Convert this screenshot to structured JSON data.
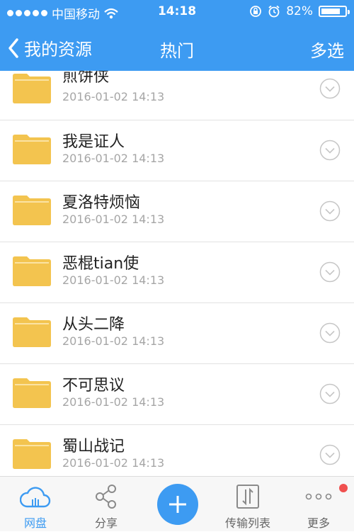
{
  "status": {
    "carrier": "中国移动",
    "time": "14:18",
    "battery": "82%",
    "battery_level": 0.82
  },
  "nav": {
    "back_label": "我的资源",
    "title": "热门",
    "action": "多选"
  },
  "files": [
    {
      "name": "煎饼侠",
      "date": "2016-01-02 14:13"
    },
    {
      "name": "我是证人",
      "date": "2016-01-02 14:13"
    },
    {
      "name": "夏洛特烦恼",
      "date": "2016-01-02 14:13"
    },
    {
      "name": "恶棍tian使",
      "date": "2016-01-02 14:13"
    },
    {
      "name": "从头二降",
      "date": "2016-01-02 14:13"
    },
    {
      "name": "不可思议",
      "date": "2016-01-02 14:13"
    },
    {
      "name": "蜀山战记",
      "date": "2016-01-02 14:13"
    }
  ],
  "tabs": {
    "netdisk": "网盘",
    "share": "分享",
    "transfer": "传输列表",
    "more": "更多"
  },
  "colors": {
    "accent": "#3d9bf2",
    "folder": "#f3c44f",
    "badge": "#f0504f"
  }
}
